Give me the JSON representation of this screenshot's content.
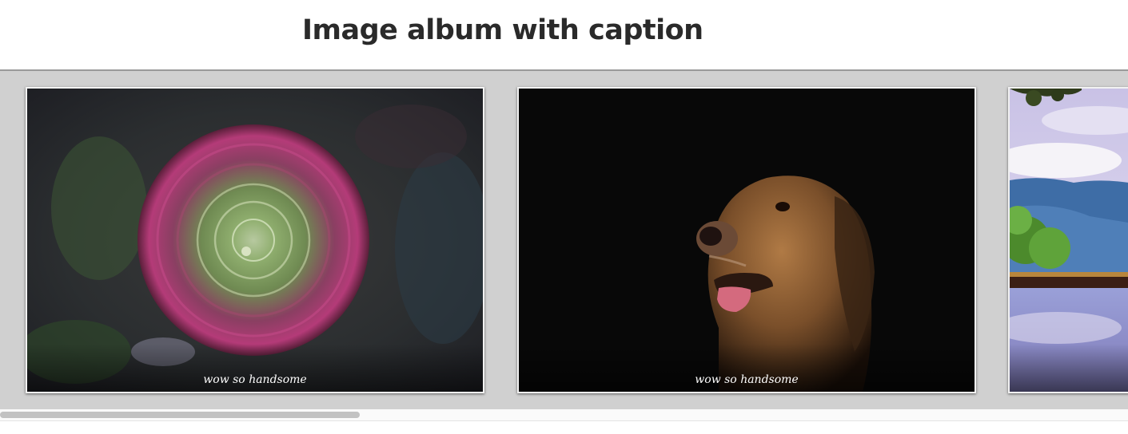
{
  "page": {
    "title": "Image album with caption"
  },
  "album": {
    "items": [
      {
        "caption": "wow so handsome",
        "image": "ranunculus-flower-photo"
      },
      {
        "caption": "wow so handsome",
        "image": "golden-retriever-photo"
      },
      {
        "caption": "",
        "image": "lake-landscape-photo"
      }
    ]
  },
  "colors": {
    "strip_background": "#d0d0d0",
    "title_text": "#2a2a2a",
    "caption_text": "#ffffff"
  },
  "scroll": {
    "position_fraction": 0.0,
    "thumb_fraction": 0.32
  }
}
